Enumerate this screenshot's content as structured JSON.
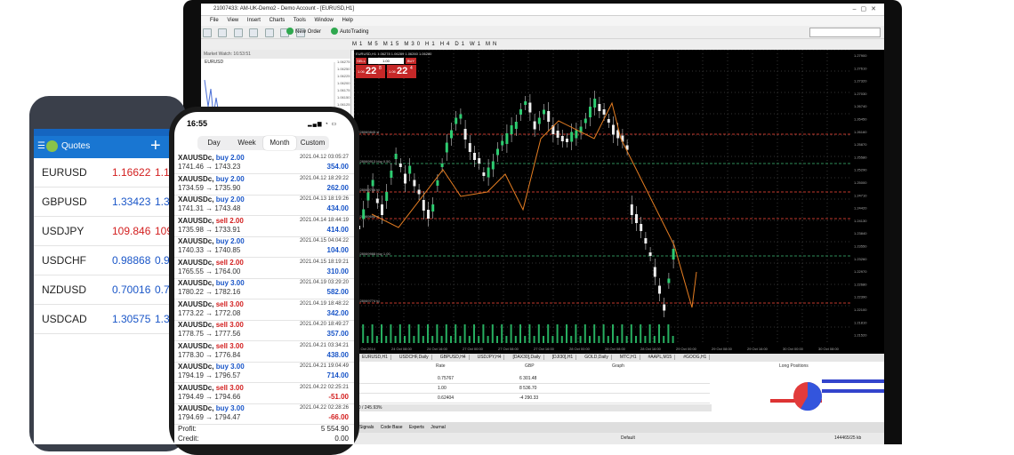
{
  "terminal": {
    "title": "21007433: AM-UK-Demo2 - Demo Account - [EURUSD,H1]",
    "menu": [
      "File",
      "View",
      "Insert",
      "Charts",
      "Tools",
      "Window",
      "Help"
    ],
    "toolbar": {
      "new_order": "New Order",
      "autotrading": "AutoTrading"
    },
    "timeframes": [
      "M1",
      "M5",
      "M15",
      "M30",
      "H1",
      "H4",
      "D1",
      "W1",
      "MN"
    ],
    "market_watch_title": "Market Watch: 16:53:51",
    "market_watch_symbol": "EURUSD",
    "mw_prices": [
      "1.06275",
      "1.06250",
      "1.06225",
      "1.06200",
      "1.06175",
      "1.06150",
      "1.06125"
    ],
    "chart_header": "EURUSD,H1 1.06278 1.06289 1.06260 1.06280",
    "one_click": {
      "sell_label": "SELL",
      "lot": "1.00",
      "buy_label": "BUY",
      "sell_price_small": "1.06",
      "sell_price_big": "22",
      "sell_sup": "8",
      "buy_price_small": "1.06",
      "buy_price_big": "22",
      "buy_sup": "4"
    },
    "price_axis": [
      "1.27900",
      "1.27610",
      "1.27320",
      "1.27030",
      "1.26740",
      "1.26450",
      "1.26160",
      "1.25870",
      "1.25580",
      "1.25290",
      "1.25000",
      "1.24710",
      "1.24420",
      "1.24130",
      "1.23840",
      "1.23550",
      "1.23260",
      "1.22970",
      "1.22680",
      "1.22390",
      "1.22100",
      "1.21810",
      "1.21520"
    ],
    "time_axis": [
      "21 Oct 2014",
      "24 Oct 08:00",
      "24 Oct 16:00",
      "27 Oct 00:00",
      "27 Oct 08:00",
      "27 Oct 16:00",
      "28 Oct 00:00",
      "28 Oct 08:00",
      "28 Oct 16:00",
      "29 Oct 00:00",
      "29 Oct 08:00",
      "29 Oct 16:00",
      "30 Oct 00:00",
      "30 Oct 08:00"
    ],
    "order_lines": [
      "#228069845 sl",
      "#228069913 buy 0.50",
      "#228069746 tp",
      "#228069698 sl",
      "#228069988 buy 1.00",
      "#228069774 tp"
    ],
    "chart_tabs": [
      "EURUSD,H1",
      "USDCHF,Daily",
      "GBPUSD,H4",
      "USDJPY,H4",
      "[DAX30],Daily",
      "[DJI30],H1",
      "GOLD,Daily",
      "MTC,H1",
      "#AAPL,M15",
      "#GOOG,H1"
    ],
    "bottom": {
      "headers": [
        "Rate",
        "GBP",
        "Graph",
        "Long Positions"
      ],
      "rows": [
        {
          "rate": "0.75767",
          "gbp": "6 301.48"
        },
        {
          "rate": "1.00",
          "gbp": "8 536.70"
        },
        {
          "rate": "0.62404",
          "gbp": "-4 290.33"
        }
      ],
      "summary": "70 / 245.93%"
    },
    "terminal_tabs": [
      "Signals",
      "Code Base",
      "Experts",
      "Journal"
    ],
    "status": {
      "profile": "Default",
      "traffic": "144465/25 kb"
    }
  },
  "android": {
    "title": "Quotes",
    "add_label": "+",
    "quotes": [
      {
        "symbol": "EURUSD",
        "bid": "1.16622",
        "ask": "1.16",
        "color": "#d32020"
      },
      {
        "symbol": "GBPUSD",
        "bid": "1.33423",
        "ask": "1.33",
        "color": "#1a56c8"
      },
      {
        "symbol": "USDJPY",
        "bid": "109.846",
        "ask": "109",
        "color": "#d32020"
      },
      {
        "symbol": "USDCHF",
        "bid": "0.98868",
        "ask": "0.98",
        "color": "#1a56c8"
      },
      {
        "symbol": "NZDUSD",
        "bid": "0.70016",
        "ask": "0.70",
        "color": "#1a56c8"
      },
      {
        "symbol": "USDCAD",
        "bid": "1.30575",
        "ask": "1.30",
        "color": "#1a56c8"
      }
    ]
  },
  "iphone": {
    "time": "16:55",
    "periods": [
      "Day",
      "Week",
      "Month",
      "Custom"
    ],
    "active_period": "Month",
    "deals": [
      {
        "sym": "XAUUSDc,",
        "side": "buy 2.00",
        "dir": "buy",
        "prices": "1741.46 → 1743.23",
        "date": "2021.04.12 03:05:27",
        "profit": "354.00",
        "sign": "pos"
      },
      {
        "sym": "XAUUSDc,",
        "side": "buy 2.00",
        "dir": "buy",
        "prices": "1734.59 → 1735.90",
        "date": "2021.04.12 18:29:22",
        "profit": "262.00",
        "sign": "pos"
      },
      {
        "sym": "XAUUSDc,",
        "side": "buy 2.00",
        "dir": "buy",
        "prices": "1741.31 → 1743.48",
        "date": "2021.04.13 18:19:26",
        "profit": "434.00",
        "sign": "pos"
      },
      {
        "sym": "XAUUSDc,",
        "side": "sell 2.00",
        "dir": "sell",
        "prices": "1735.98 → 1733.91",
        "date": "2021.04.14 18:44:19",
        "profit": "414.00",
        "sign": "pos"
      },
      {
        "sym": "XAUUSDc,",
        "side": "buy 2.00",
        "dir": "buy",
        "prices": "1740.33 → 1740.85",
        "date": "2021.04.15 04:04:22",
        "profit": "104.00",
        "sign": "pos"
      },
      {
        "sym": "XAUUSDc,",
        "side": "sell 2.00",
        "dir": "sell",
        "prices": "1765.55 → 1764.00",
        "date": "2021.04.15 18:19:21",
        "profit": "310.00",
        "sign": "pos"
      },
      {
        "sym": "XAUUSDc,",
        "side": "buy 3.00",
        "dir": "buy",
        "prices": "1780.22 → 1782.16",
        "date": "2021.04.19 03:29:20",
        "profit": "582.00",
        "sign": "pos"
      },
      {
        "sym": "XAUUSDc,",
        "side": "sell 3.00",
        "dir": "sell",
        "prices": "1773.22 → 1772.08",
        "date": "2021.04.19 18:48:22",
        "profit": "342.00",
        "sign": "pos"
      },
      {
        "sym": "XAUUSDc,",
        "side": "sell 3.00",
        "dir": "sell",
        "prices": "1778.75 → 1777.56",
        "date": "2021.04.20 18:49:27",
        "profit": "357.00",
        "sign": "pos"
      },
      {
        "sym": "XAUUSDc,",
        "side": "sell 3.00",
        "dir": "sell",
        "prices": "1778.30 → 1776.84",
        "date": "2021.04.21 03:34:21",
        "profit": "438.00",
        "sign": "pos"
      },
      {
        "sym": "XAUUSDc,",
        "side": "buy 3.00",
        "dir": "buy",
        "prices": "1794.19 → 1796.57",
        "date": "2021.04.21 19:04:49",
        "profit": "714.00",
        "sign": "pos"
      },
      {
        "sym": "XAUUSDc,",
        "side": "sell 3.00",
        "dir": "sell",
        "prices": "1794.49 → 1794.66",
        "date": "2021.04.22 02:25:21",
        "profit": "-51.00",
        "sign": "neg"
      },
      {
        "sym": "XAUUSDc,",
        "side": "buy 3.00",
        "dir": "buy",
        "prices": "1794.69 → 1794.47",
        "date": "2021.04.22 02:28:26",
        "profit": "-66.00",
        "sign": "neg"
      }
    ],
    "summary": [
      {
        "label": "Profit:",
        "value": "5 554.90"
      },
      {
        "label": "Credit:",
        "value": "0.00"
      }
    ]
  }
}
